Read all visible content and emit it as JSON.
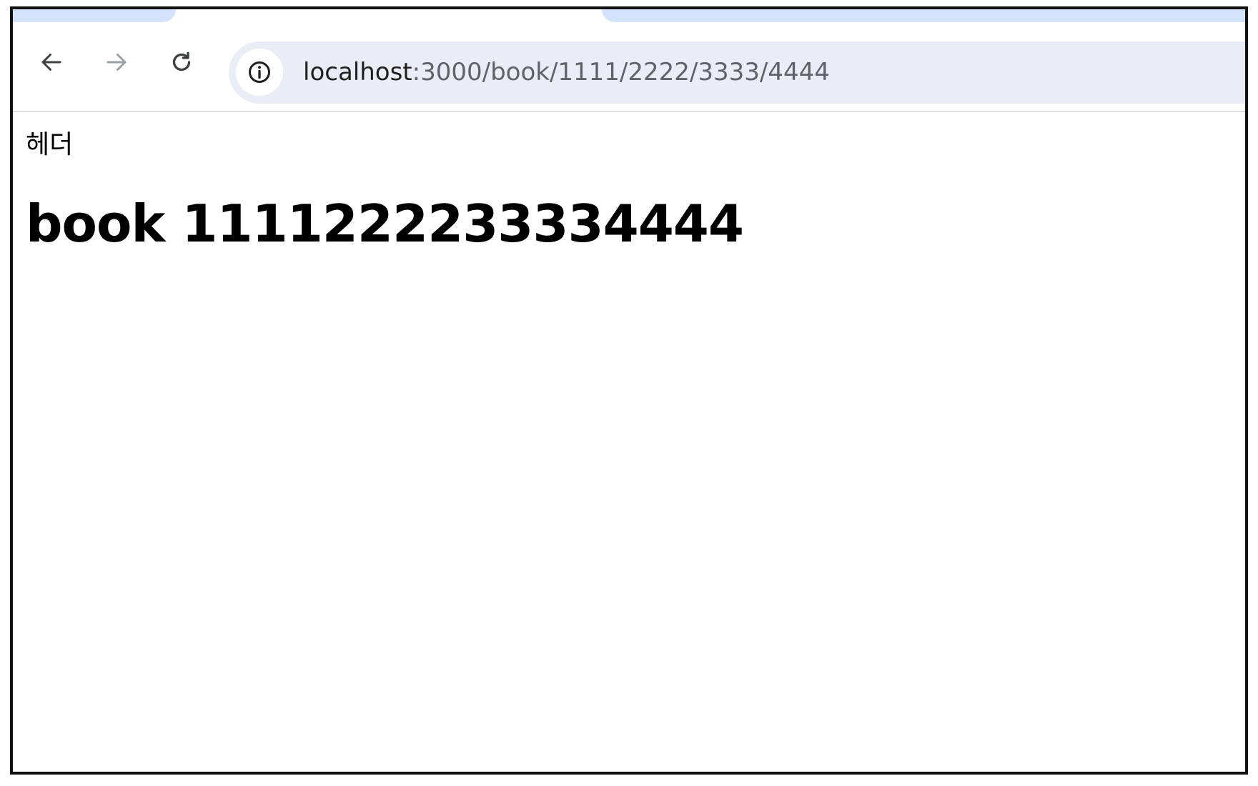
{
  "browser": {
    "toolbar": {
      "back_icon": "arrow-left-icon",
      "forward_icon": "arrow-right-icon",
      "reload_icon": "reload-icon"
    },
    "omnibox": {
      "site_info_icon": "info-circle-icon",
      "url_host": "localhost",
      "url_path": ":3000/book/1111/2222/3333/4444"
    },
    "colors": {
      "tab_accent": "#d3e3fd",
      "omnibox_bg": "#e9eef6",
      "icon_active": "#3c4043",
      "icon_disabled": "#9aa0a6"
    }
  },
  "page": {
    "header": "헤더",
    "title": "book 1111222233334444"
  }
}
